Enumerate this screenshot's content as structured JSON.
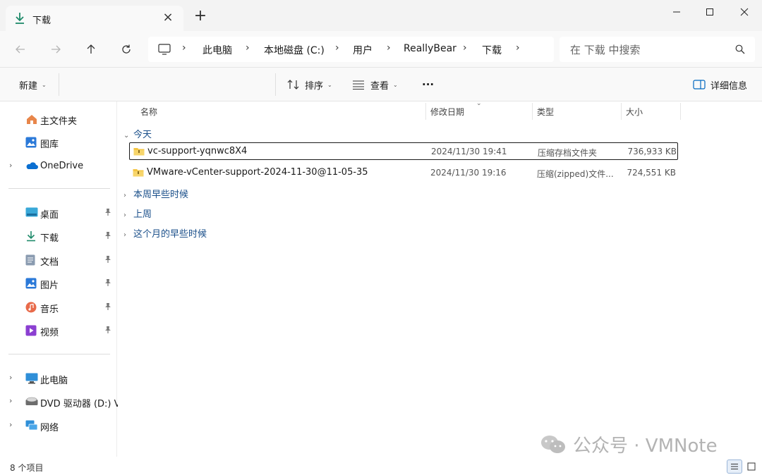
{
  "tab": {
    "title": "下载",
    "new_tab": "+"
  },
  "address": {
    "crumbs": [
      "此电脑",
      "本地磁盘 (C:)",
      "用户",
      "ReallyBear",
      "下载"
    ],
    "separator": "›"
  },
  "search": {
    "placeholder": "在 下载 中搜索"
  },
  "commands": {
    "new": "新建",
    "sort": "排序",
    "view": "查看",
    "more": "···",
    "details": "详细信息"
  },
  "sidebar": {
    "home": "主文件夹",
    "gallery": "图库",
    "onedrive": "OneDrive",
    "pinned": [
      "桌面",
      "下载",
      "文档",
      "图片",
      "音乐",
      "视频"
    ],
    "pc": "此电脑",
    "dvd": "DVD 驱动器 (D:) VI",
    "network": "网络"
  },
  "columns": {
    "name": "名称",
    "date": "修改日期",
    "type": "类型",
    "size": "大小"
  },
  "groups": {
    "today": "今天",
    "earlier_week": "本周早些时候",
    "last_week": "上周",
    "earlier_month": "这个月的早些时候"
  },
  "files": [
    {
      "name": "vc-support-yqnwc8X4",
      "date": "2024/11/30 19:41",
      "type": "压缩存档文件夹",
      "size": "736,933 KB"
    },
    {
      "name": "VMware-vCenter-support-2024-11-30@11-05-35",
      "date": "2024/11/30 19:16",
      "type": "压缩(zipped)文件...",
      "size": "724,551 KB"
    }
  ],
  "status": {
    "count": "8 个项目"
  },
  "watermark": {
    "text": "公众号 · VMNote"
  },
  "colors": {
    "accent": "#0067c0",
    "folder_yellow": "#f4c542",
    "group_text": "#1a4f8a"
  }
}
